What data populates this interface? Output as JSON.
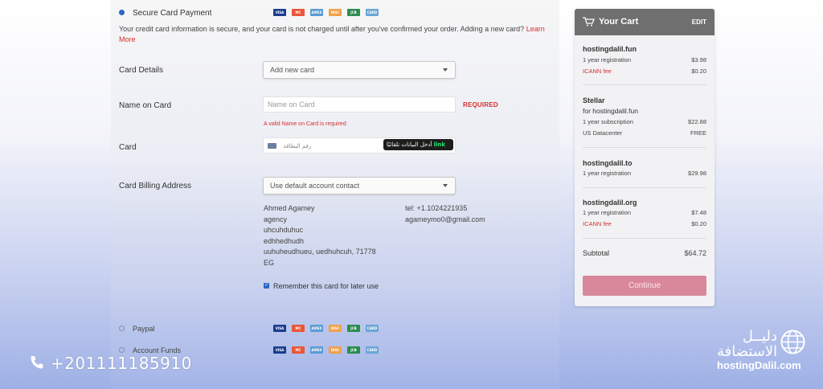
{
  "payment": {
    "secure_label": "Secure Card Payment",
    "info_text": "Your credit card information is secure, and your card is not charged until after you've confirmed your order. Adding a new card?",
    "learn_more": "Learn More",
    "card_icons": [
      {
        "name": "visa-icon",
        "text": "VISA",
        "color": "#1a3d8f"
      },
      {
        "name": "mastercard-icon",
        "text": "MC",
        "color": "#e9563a"
      },
      {
        "name": "amex-icon",
        "text": "AMEX",
        "color": "#5b9bd5"
      },
      {
        "name": "discover-icon",
        "text": "DISC",
        "color": "#f0a04b"
      },
      {
        "name": "jcb-icon",
        "text": "JCB",
        "color": "#2c8c4f"
      },
      {
        "name": "card-generic-icon",
        "text": "CARD",
        "color": "#6aa6d8"
      }
    ]
  },
  "form": {
    "card_details_label": "Card Details",
    "card_details_value": "Add new card",
    "name_label": "Name on Card",
    "name_placeholder": "Name on Card",
    "required_text": "REQUIRED",
    "name_error": "A valid Name on Card is required",
    "card_label": "Card",
    "card_placeholder": "رقم البطاقة",
    "link_badge_arabic": "أدخل البيانات تلقائيًا",
    "link_badge_brand": "link",
    "billing_label": "Card Billing Address",
    "billing_value": "Use default account contact",
    "address_lines": [
      "Ahmed Agamey",
      "agency",
      "uhcuhduhuc",
      "edhhedhudh",
      "uuhuheudhueu, uedhuhcuh, 71778",
      "EG"
    ],
    "contact_tel": "tel: +1.1024221935",
    "contact_email": "agameymo0@gmail.com",
    "remember_label": "Remember this card for later use"
  },
  "methods": {
    "paypal_label": "Paypal",
    "account_funds_label": "Account Funds"
  },
  "cart": {
    "title": "Your Cart",
    "edit": "EDIT",
    "items": [
      {
        "name": "hostingdalil.fun",
        "lines": [
          {
            "label": "1 year registration",
            "price": "$3.98"
          },
          {
            "label": "ICANN fee",
            "price": "$0.20",
            "red": true
          }
        ]
      },
      {
        "name": "Stellar",
        "sub": "for hostingdalil.fun",
        "lines": [
          {
            "label": "1 year subscription",
            "price": "$22.88"
          },
          {
            "label": "US Datacenter",
            "price": "FREE"
          }
        ]
      },
      {
        "name": "hostingdalil.to",
        "lines": [
          {
            "label": "1 year registration",
            "price": "$29.98"
          }
        ]
      },
      {
        "name": "hostingdalil.org",
        "lines": [
          {
            "label": "1 year registration",
            "price": "$7.48"
          },
          {
            "label": "ICANN fee",
            "price": "$0.20",
            "red": true
          }
        ]
      }
    ],
    "subtotal_label": "Subtotal",
    "subtotal_value": "$64.72",
    "continue_label": "Continue"
  },
  "watermark": {
    "phone": "+201111185910",
    "brand_arabic_1": "دليــل",
    "brand_arabic_2": "الاستضافة",
    "brand_english": "hostingDalil.com"
  }
}
